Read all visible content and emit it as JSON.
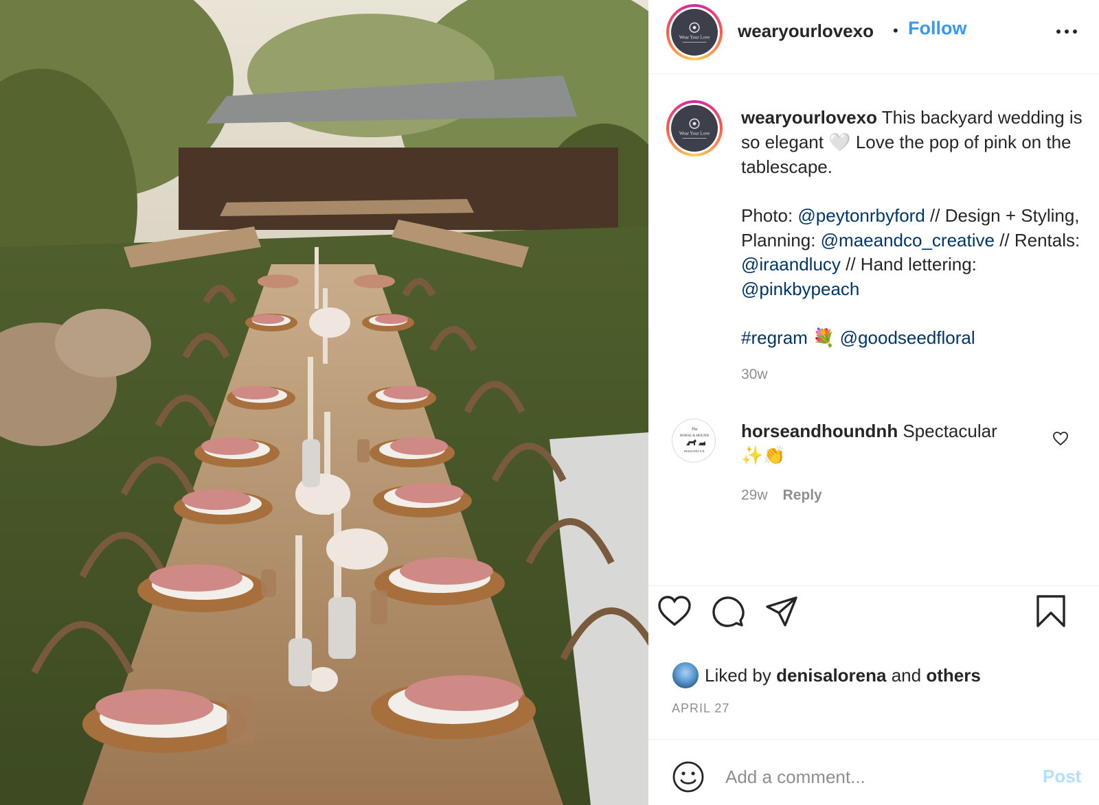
{
  "post": {
    "username": "wearyourlovexo",
    "dot": "•",
    "follow_label": "Follow",
    "more_icon": "more-horizontal-icon",
    "avatar_text": "Wear Your Love"
  },
  "caption": {
    "username": "wearyourlovexo",
    "line1": " This backyard wedding is so elegant ",
    "heart_emoji": "🤍",
    "line2": " Love the pop of pink on the tablescape.",
    "photo_label": "Photo: ",
    "mention_photographer": "@peytonrbyford",
    "design_label": " // Design + Styling, Planning: ",
    "mention_design": "@maeandco_creative",
    "rentals_label": " // Rentals: ",
    "mention_rentals": "@iraandlucy",
    "lettering_label": " // Hand lettering: ",
    "mention_lettering": "@pinkbypeach",
    "hashtag": "#regram",
    "flower_emoji": "💐",
    "mention_floral": "@goodseedfloral",
    "age": "30w"
  },
  "comment": {
    "username": "horseandhoundnh",
    "text": " Spectacular",
    "emojis": "✨👏",
    "age": "29w",
    "reply_label": "Reply",
    "avatar_line1": "The",
    "avatar_line2": "HORSE & HOUND",
    "avatar_line3": "FRANCONIA   N.H."
  },
  "actions": {
    "like_icon": "heart-icon",
    "comment_icon": "comment-icon",
    "share_icon": "share-icon",
    "save_icon": "bookmark-icon"
  },
  "likes": {
    "prefix": "Liked by ",
    "user": "denisalorena",
    "middle": " and ",
    "others": "others"
  },
  "date": "APRIL 27",
  "comment_box": {
    "placeholder": "Add a comment...",
    "post_label": "Post"
  },
  "colors": {
    "follow": "#3897f0",
    "link": "#00376b",
    "muted": "#8e8e8e",
    "post_disabled": "#b2dffc"
  }
}
